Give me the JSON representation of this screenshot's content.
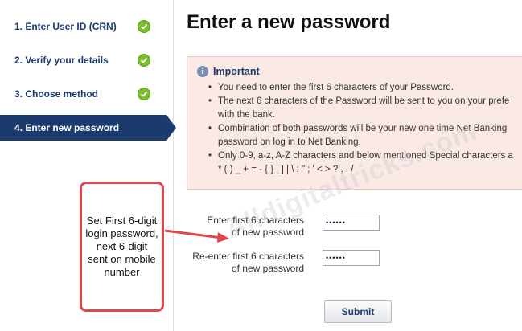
{
  "sidebar": {
    "steps": [
      {
        "label": "1. Enter User ID (CRN)",
        "completed": true
      },
      {
        "label": "2. Verify your details",
        "completed": true
      },
      {
        "label": "3. Choose method",
        "completed": true
      },
      {
        "label": "4. Enter new password",
        "active": true
      }
    ]
  },
  "main": {
    "title": "Enter a new password",
    "important": {
      "heading": "Important",
      "bullets": [
        {
          "line1": "You need to enter the first 6 characters of your Password."
        },
        {
          "line1": "The next 6 characters of the Password will be sent to you on your prefe",
          "line2": "with the bank."
        },
        {
          "line1": "Combination of both passwords will be your new one time Net Banking",
          "line2": "password on log in to Net Banking."
        },
        {
          "line1": "Only 0-9, a-z, A-Z characters and below mentioned Special characters a",
          "line2": "* ( ) _ + = - { } [ ] | \\ : \" ; ' < > ? , . /"
        }
      ]
    },
    "fields": {
      "first": {
        "label_line1": "Enter first 6 characters",
        "label_line2": "of new password",
        "value": "••••••"
      },
      "reenter": {
        "label_line1": "Re-enter first 6 characters",
        "label_line2": "of new password",
        "value": "••••••"
      }
    },
    "submit_label": "Submit"
  },
  "annotation": {
    "text": "Set First 6-digit login password, next 6-digit sent on mobile number",
    "border_color": "#e0474c"
  },
  "watermark": "Alldigitaltricks.com",
  "colors": {
    "navy": "#1b3b6f",
    "check_green": "#7bbf2c",
    "notice_bg": "#fbe9e6"
  }
}
